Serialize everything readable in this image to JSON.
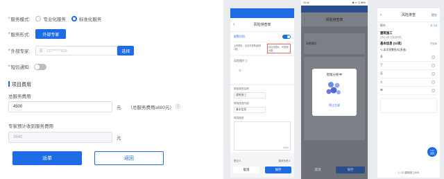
{
  "form": {
    "service_mode": {
      "label": "服务模式:",
      "options": [
        "专业化服务",
        "标准化服务"
      ],
      "selected": 1
    },
    "service_form": {
      "label": "服务形式:",
      "button": "外部专家"
    },
    "external_expert": {
      "label": "外部专家:",
      "placeholder": "姜 · 137****7928",
      "select_button": "选择"
    },
    "sms_notify": {
      "label": "短信通知:"
    },
    "section_title": "项目费用",
    "total_fee": {
      "label": "总服务费用",
      "value": "4500",
      "unit": "元",
      "note": "（总服务费用≥600元）",
      "info_icon": "ⓘ"
    },
    "expert_fee": {
      "label": "专家预计收到服务费用",
      "value": "3640",
      "unit": "元"
    },
    "submit_button": "派单",
    "back_button": "返回"
  },
  "phone1": {
    "title": "风险排查单",
    "tab": "报警识别",
    "meta_left": "上传照片、点击可查看(最多1张)",
    "meta_right": "请点击图片、可查看大图",
    "section": "风险图片①",
    "add_icon": "+",
    "field1_label": "风险排查名称",
    "field1_value": "建筑施工",
    "field2_label": "风险排查内容",
    "field2_value": "基本信息",
    "field3_label": "风险描述",
    "counter": "0/500",
    "footer_label_left": "提交人",
    "footer_label_right": "整改负责人",
    "cancel": "取消",
    "save": "保存"
  },
  "phone2": {
    "status_time": "10:44",
    "status_right": "✱ ᯤ ◫ 88%",
    "title": "风险排查单",
    "section": "风险图片",
    "modal_title": "智能分析中",
    "modal_stop": "停止生成",
    "cancel": "取消",
    "save": "保存"
  },
  "phone3": {
    "title": "风险排查",
    "action": "提交",
    "progress": "8 / 12",
    "field_label": "模块",
    "section_title": "建筑施工",
    "section_sub": "(共8小项 已检查8项)",
    "item_title": "基本信息 (11项)",
    "not_applicable": "不适用",
    "question": "*1.本次宣教形式(多选)",
    "options": [
      "多",
      "了",
      "兵",
      "土",
      "单"
    ],
    "pager": "1 / 12  建筑施工(8/8)",
    "fab_label": "1/12\n返回"
  },
  "colors": {
    "primary": "#1e6be6",
    "required": "#e4393c"
  }
}
